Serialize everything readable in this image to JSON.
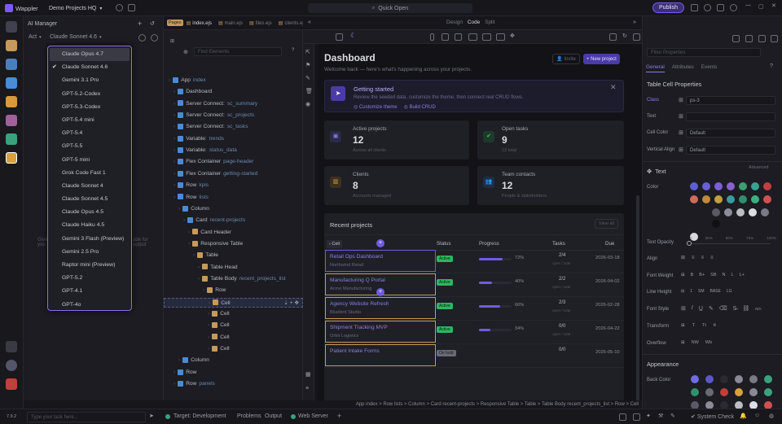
{
  "app": {
    "name": "Wappler",
    "project": "Demo Projects HQ",
    "search": "Quick Open",
    "publish": "Publish"
  },
  "tabs": {
    "pages_badge": "Pages",
    "items": [
      "index.ejs",
      "main.ejs",
      "files.ejs",
      "clients.ejs"
    ]
  },
  "ai": {
    "title": "AI Manager",
    "mode": "Act",
    "model": "Claude Sonnet 4.6",
    "hint_left": "Give\nyou",
    "hint_right": "ode for\noutput"
  },
  "models": [
    {
      "label": "Claude Opus 4.7",
      "selected": false,
      "hover": true
    },
    {
      "label": "Claude Sonnet 4.6",
      "selected": true
    },
    {
      "label": "Gemini 3.1 Pro"
    },
    {
      "label": "GPT-5.2-Codex"
    },
    {
      "label": "GPT-5.3-Codex"
    },
    {
      "label": "GPT-5.4 mini"
    },
    {
      "label": "GPT-5.4"
    },
    {
      "label": "GPT-5.5"
    },
    {
      "label": "GPT-5 mini"
    },
    {
      "label": "Grok Code Fast 1"
    },
    {
      "label": "Claude Sonnet 4"
    },
    {
      "label": "Claude Sonnet 4.5"
    },
    {
      "label": "Claude Opus 4.5"
    },
    {
      "label": "Claude Haiku 4.5"
    },
    {
      "label": "Gemini 3 Flash (Preview)"
    },
    {
      "label": "Gemini 2.5 Pro"
    },
    {
      "label": "Raptor mini (Preview)"
    },
    {
      "label": "GPT-5.2"
    },
    {
      "label": "GPT-4.1"
    },
    {
      "label": "GPT-4o"
    }
  ],
  "tree": {
    "search_placeholder": "Find Elements",
    "nodes": [
      {
        "t": "App",
        "n": "index",
        "d": 0
      },
      {
        "t": "Dashboard",
        "n": "",
        "d": 1
      },
      {
        "t": "Server Connect:",
        "n": "sc_summary",
        "d": 1
      },
      {
        "t": "Server Connect:",
        "n": "sc_projects",
        "d": 1
      },
      {
        "t": "Server Connect:",
        "n": "sc_tasks",
        "d": 1
      },
      {
        "t": "Variable:",
        "n": "trends",
        "d": 1
      },
      {
        "t": "Variable:",
        "n": "status_data",
        "d": 1
      },
      {
        "t": "Flex Container",
        "n": "page-header",
        "d": 1
      },
      {
        "t": "Flex Container",
        "n": "getting-started",
        "d": 1
      },
      {
        "t": "Row",
        "n": "kpis",
        "d": 1
      },
      {
        "t": "Row",
        "n": "lists",
        "d": 1
      },
      {
        "t": "Column",
        "n": "",
        "d": 2
      },
      {
        "t": "Card",
        "n": "recent-projects",
        "d": 3
      },
      {
        "t": "Card Header",
        "n": "",
        "d": 4
      },
      {
        "t": "Responsive Table",
        "n": "",
        "d": 4
      },
      {
        "t": "Table",
        "n": "",
        "d": 5
      },
      {
        "t": "Table Head",
        "n": "",
        "d": 6
      },
      {
        "t": "Table Body",
        "n": "recent_projects_list",
        "d": 6
      },
      {
        "t": "Row",
        "n": "",
        "d": 7
      },
      {
        "t": "Cell",
        "n": "",
        "d": 8
      },
      {
        "t": "Cell",
        "n": "",
        "d": 8
      },
      {
        "t": "Cell",
        "n": "",
        "d": 8
      },
      {
        "t": "Cell",
        "n": "",
        "d": 8
      },
      {
        "t": "Cell",
        "n": "",
        "d": 8
      },
      {
        "t": "Column",
        "n": "",
        "d": 2
      },
      {
        "t": "Row",
        "n": "",
        "d": 1
      },
      {
        "t": "Row",
        "n": "panels",
        "d": 1
      }
    ]
  },
  "editor": {
    "view_modes": [
      "Design",
      "Code",
      "Split"
    ],
    "title": "Dashboard",
    "subtitle": "Welcome back — here's what's happening across your projects.",
    "btn_invite": "Invite",
    "btn_new": "+ New project",
    "getting_started": {
      "title": "Getting started",
      "body": "Review the seeded data, customize the theme, then connect real CRUD flows.",
      "links": [
        "Customize theme",
        "Build CRUD"
      ]
    },
    "kpis": [
      {
        "label": "Active projects",
        "value": "12",
        "sub": "Across all clients"
      },
      {
        "label": "Open tasks",
        "value": "9",
        "sub": "13 total"
      },
      {
        "label": "Clients",
        "value": "8",
        "sub": "Accounts managed"
      },
      {
        "label": "Team contacts",
        "value": "12",
        "sub": "People & stakeholders"
      }
    ],
    "recent": {
      "title": "Recent projects",
      "view_all": "View all",
      "cell_tag": "Cell",
      "columns": [
        "",
        "Status",
        "Progress",
        "Tasks",
        "Due"
      ],
      "rows": [
        {
          "name": "Retail Ops Dashboard",
          "client": "Northwind Retail",
          "status": "Active",
          "progress": "72%",
          "pct": 72,
          "tasks": "2/4",
          "tsub": "open / total",
          "due": "2026-03-18"
        },
        {
          "name": "Manufacturing Q Portal",
          "client": "Acme Manufacturing",
          "status": "Active",
          "progress": "40%",
          "pct": 40,
          "tasks": "2/2",
          "tsub": "open / total",
          "due": "2026-04-02"
        },
        {
          "name": "Agency Website Refresh",
          "client": "Bluebird Studio",
          "status": "Active",
          "progress": "66%",
          "pct": 66,
          "tasks": "2/3",
          "tsub": "open / total",
          "due": "2026-02-28"
        },
        {
          "name": "Shipment Tracking MVP",
          "client": "Orbit Logistics",
          "status": "Active",
          "progress": "34%",
          "pct": 34,
          "tasks": "0/0",
          "tsub": "open / total",
          "due": "2026-04-22"
        },
        {
          "name": "Patient Intake Forms",
          "client": "",
          "status": "On hold",
          "progress": "",
          "pct": 0,
          "tasks": "0/0",
          "tsub": "",
          "due": "2026-05-10"
        }
      ]
    }
  },
  "props": {
    "filter_placeholder": "Filter Properties",
    "tabs": [
      "General",
      "Attributes",
      "Events"
    ],
    "section": "Table Cell Properties",
    "class_label": "Class",
    "class_value": "ps-3",
    "text_label": "Text",
    "cell_color_label": "Cell Color",
    "cell_color_value": "Default",
    "valign_label": "Vertical Align",
    "valign_value": "Default",
    "text_section": "Text",
    "advanced": "Advanced",
    "color_label": "Color",
    "opacity_label": "Text Opacity",
    "opacity_ticks": [
      "0",
      "25%",
      "50%",
      "75%",
      "100%"
    ],
    "align_label": "Align",
    "weight_label": "Font Weight",
    "weights": [
      "B",
      "B+",
      "SB",
      "N",
      "L",
      "L+"
    ],
    "lh_label": "Line Height",
    "lh": [
      "1",
      "SM",
      "BASE",
      "LG"
    ],
    "style_label": "Font Style",
    "transform_label": "Transform",
    "transforms": [
      "T",
      "Tt",
      "tt"
    ],
    "overflow_label": "Overflow",
    "overflows": [
      "NW",
      "Wb"
    ],
    "appearance": "Appearance",
    "back_label": "Back Color",
    "palette": [
      "#6f6be0",
      "#5b57c6",
      "#8e7fd8",
      "#9a6fd0",
      "#c75f8f",
      "#d55a5a",
      "#2f8f6f",
      "#3aa17d"
    ]
  },
  "statusbar": {
    "version": "7.9.2",
    "prompt_placeholder": "Type your task here...",
    "target": "Target: Development",
    "problems": "Problems",
    "output": "Output",
    "web_server": "Web Server",
    "system_check": "System Check",
    "breadcrumb": "App index > Row lists > Column > Card recent-projects > Responsive Table > Table > Table Body recent_projects_list > Row > Cell"
  },
  "colors": {
    "accent": "#7b5cf0",
    "active_badge": "#2fb560",
    "panel": "#1c1c22"
  }
}
